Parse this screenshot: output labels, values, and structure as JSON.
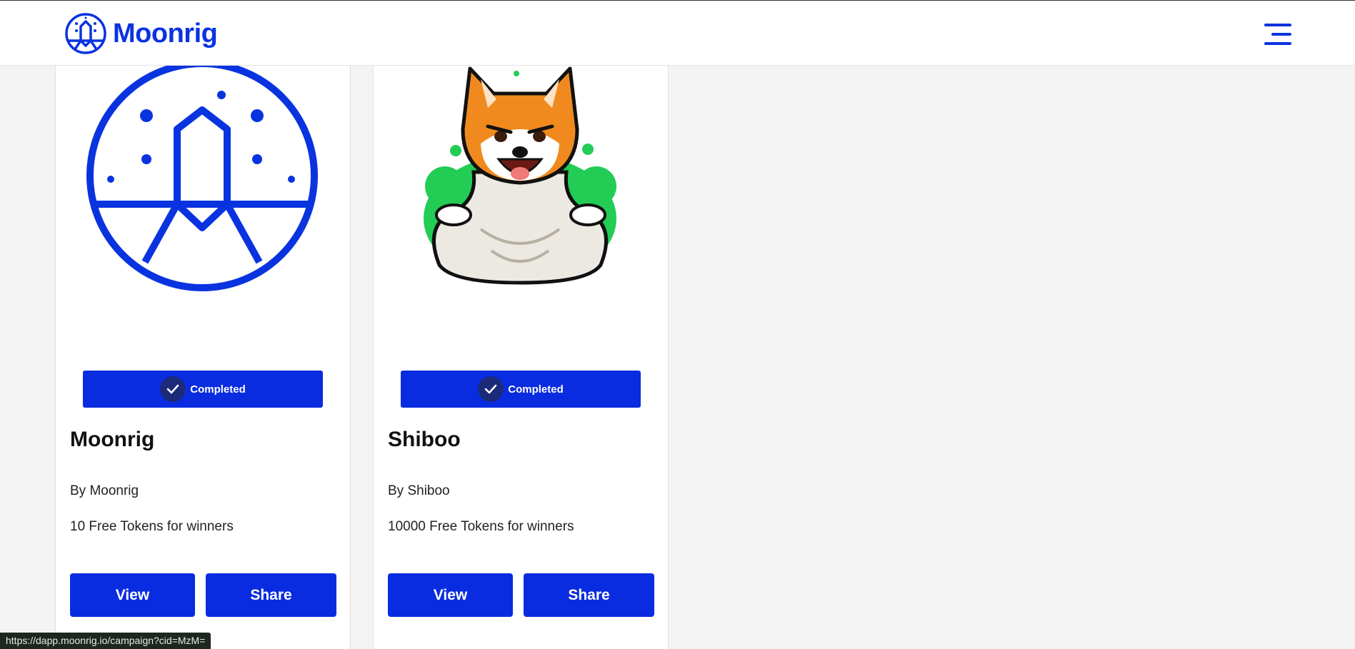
{
  "header": {
    "brand_name": "Moonrig",
    "icons": {
      "logo": "moonrig-logo-icon",
      "menu": "hamburger-menu-icon"
    }
  },
  "colors": {
    "brand_blue": "#0a33e0",
    "button_blue": "#0a2ce0",
    "page_bg": "#f3f3f3"
  },
  "campaigns": [
    {
      "image": "moonrig-logo-image",
      "status": "Completed",
      "title": "Moonrig",
      "by": "By Moonrig",
      "reward": "10 Free Tokens for winners",
      "view_label": "View",
      "share_label": "Share"
    },
    {
      "image": "shiba-ghost-mascot-image",
      "status": "Completed",
      "title": "Shiboo",
      "by": "By Shiboo",
      "reward": "10000 Free Tokens for winners",
      "view_label": "View",
      "share_label": "Share"
    }
  ],
  "status_bar": {
    "url": "https://dapp.moonrig.io/campaign?cid=MzM="
  }
}
